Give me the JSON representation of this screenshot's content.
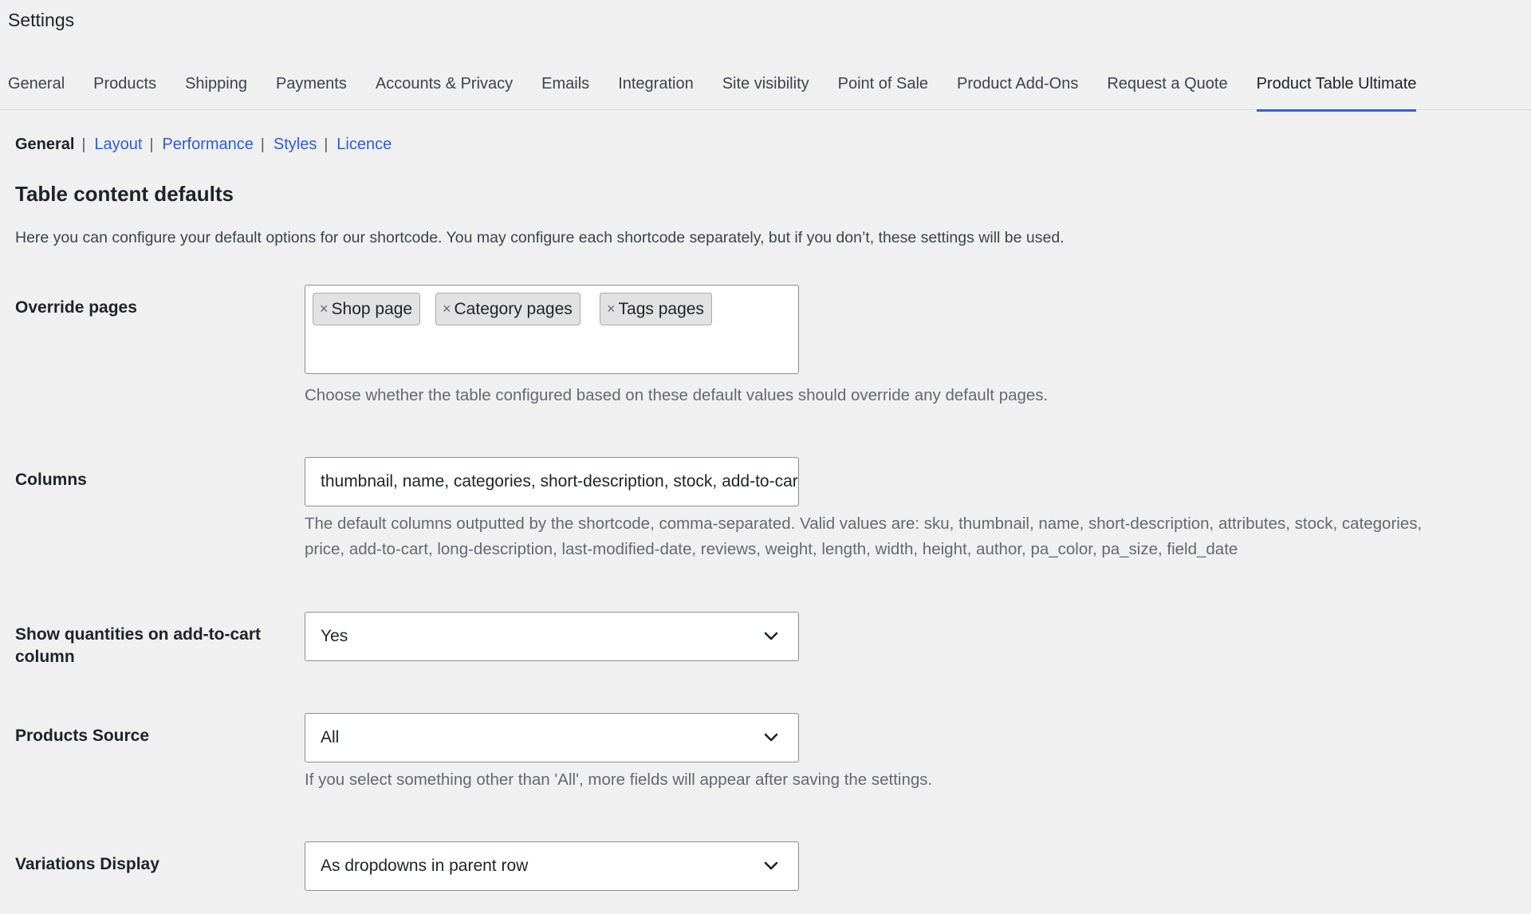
{
  "page": {
    "title": "Settings"
  },
  "tabs": [
    {
      "label": "General"
    },
    {
      "label": "Products"
    },
    {
      "label": "Shipping"
    },
    {
      "label": "Payments"
    },
    {
      "label": "Accounts & Privacy"
    },
    {
      "label": "Emails"
    },
    {
      "label": "Integration"
    },
    {
      "label": "Site visibility"
    },
    {
      "label": "Point of Sale"
    },
    {
      "label": "Product Add-Ons"
    },
    {
      "label": "Request a Quote"
    },
    {
      "label": "Product Table Ultimate",
      "active": true
    }
  ],
  "subnav": {
    "general": "General",
    "layout": "Layout",
    "performance": "Performance",
    "styles": "Styles",
    "licence": "Licence",
    "separator": "|"
  },
  "section": {
    "title": "Table content defaults",
    "description": "Here you can configure your default options for our shortcode. You may configure each shortcode separately, but if you don’t, these settings will be used."
  },
  "fields": {
    "override_pages": {
      "label": "Override pages",
      "remove_symbol": "×",
      "tags": [
        "Shop page",
        "Category pages",
        "Tags pages"
      ],
      "help": "Choose whether the table configured based on these default values should override any default pages."
    },
    "columns": {
      "label": "Columns",
      "value": "thumbnail, name, categories, short-description, stock, add-to-cart",
      "help_line1": "The default columns outputted by the shortcode, comma-separated. Valid values are: sku, thumbnail, name, short-description, attributes, stock, categories,",
      "help_line2": "price, add-to-cart, long-description, last-modified-date, reviews, weight, length, width, height, author, pa_color, pa_size, field_date"
    },
    "show_quantities": {
      "label": "Show quantities on add-to-cart column",
      "value": "Yes"
    },
    "products_source": {
      "label": "Products Source",
      "value": "All",
      "help": "If you select something other than 'All', more fields will appear after saving the settings."
    },
    "variations_display": {
      "label": "Variations Display",
      "value": "As dropdowns in parent row"
    }
  },
  "icons": {
    "remove": "close-icon",
    "dropdown": "chevron-down-icon"
  },
  "colors": {
    "background": "#f0f0f1",
    "accent": "#3858e9",
    "link": "#2c5fd4"
  }
}
